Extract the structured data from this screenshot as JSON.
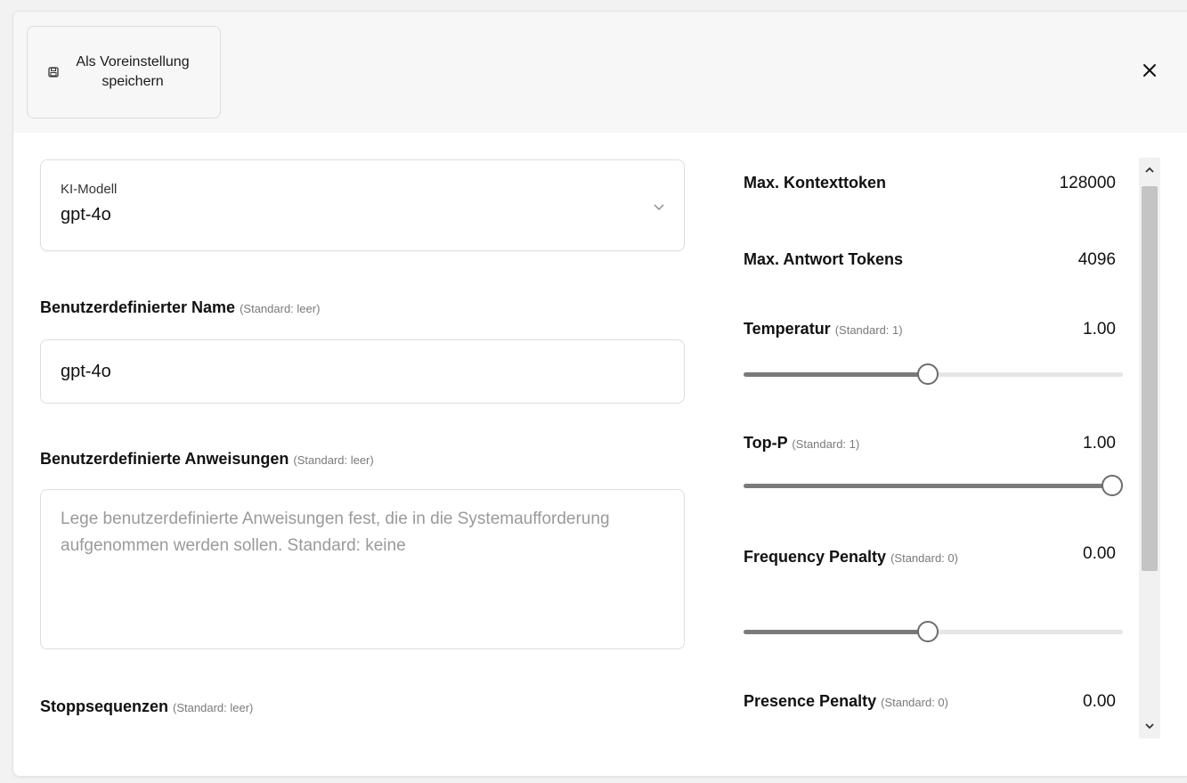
{
  "header": {
    "save_preset_label": "Als Voreinstellung speichern",
    "save_icon": "save-icon",
    "close_icon": "close-icon"
  },
  "model_select": {
    "label": "KI-Modell",
    "value": "gpt-4o"
  },
  "custom_name": {
    "label": "Benutzerdefinierter Name",
    "hint": "(Standard: leer)",
    "value": "gpt-4o"
  },
  "custom_instructions": {
    "label": "Benutzerdefinierte Anweisungen",
    "hint": "(Standard: leer)",
    "placeholder": "Lege benutzerdefinierte Anweisungen fest, die in die Systemaufforderung aufgenommen werden sollen. Standard: keine"
  },
  "stop_sequences": {
    "label": "Stoppsequenzen",
    "hint": "(Standard: leer)"
  },
  "params": {
    "max_context": {
      "label": "Max. Kontexttoken",
      "value": "128000"
    },
    "max_response": {
      "label": "Max. Antwort Tokens",
      "value": "4096"
    },
    "temperature": {
      "label": "Temperatur",
      "hint": "(Standard: 1)",
      "value": "1.00",
      "fraction": 0.5
    },
    "top_p": {
      "label": "Top-P",
      "hint": "(Standard: 1)",
      "value": "1.00",
      "fraction": 1.0
    },
    "frequency_penalty": {
      "label": "Frequency Penalty",
      "hint": "(Standard: 0)",
      "value": "0.00",
      "fraction": 0.5
    },
    "presence_penalty": {
      "label": "Presence Penalty",
      "hint": "(Standard: 0)",
      "value": "0.00"
    }
  },
  "colors": {
    "slider_fill": "#7a7a7a",
    "slider_track": "#e6e6e6",
    "header_bg": "#f7f7f7"
  }
}
